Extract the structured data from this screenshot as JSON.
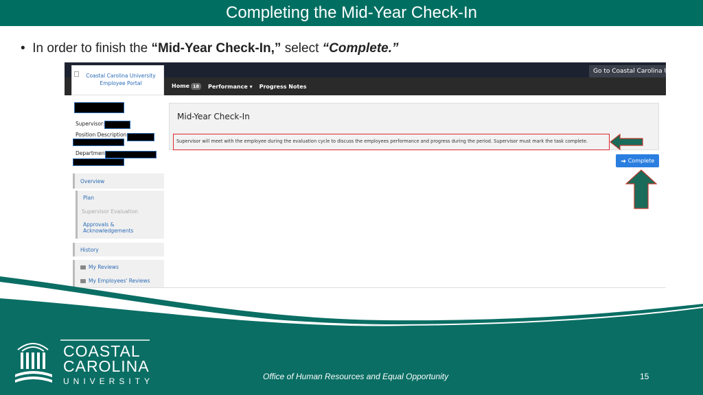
{
  "slide": {
    "title": "Completing the Mid-Year Check-In",
    "bullet": {
      "prefix": "In order to finish the ",
      "bold": "“Mid-Year Check-In,”",
      "middle": " select ",
      "bold_italic": "“Complete.”"
    },
    "footer": "Office of Human Resources and Equal Opportunity",
    "page_number": "15",
    "logo": {
      "line1": "COASTAL",
      "line2": "CAROLINA",
      "line3": "UNIVERSITY"
    }
  },
  "portal": {
    "logo_text_line1": "Coastal Carolina University",
    "logo_text_line2": "Employee Portal",
    "goto_label": "Go to Coastal Carolina Univ",
    "nav": {
      "home": "Home",
      "home_badge": "18",
      "performance": "Performance",
      "progress_notes": "Progress Notes"
    },
    "profile": {
      "supervisor_label": "Supervisor:",
      "position_label": "Position Description:",
      "department_label": "Department:"
    },
    "sidebar": {
      "overview": "Overview",
      "plan": "Plan",
      "supervisor_evaluation": "Supervisor Evaluation",
      "approvals_line1": "Approvals &",
      "approvals_line2": "Acknowledgements",
      "history": "History",
      "my_reviews": "My Reviews",
      "my_employees_reviews": "My Employees' Reviews"
    },
    "panel": {
      "title": "Mid-Year Check-In",
      "description": "Supervisor will meet with the employee during the evaluation cycle to discuss the employees performance and progress during the period. Supervisor must mark the task complete."
    },
    "complete_button": "Complete"
  },
  "colors": {
    "brand_teal": "#006f62",
    "arrow_fill": "#1a6b5a",
    "highlight_red": "#e0262b",
    "button_blue": "#2a7ee0"
  }
}
